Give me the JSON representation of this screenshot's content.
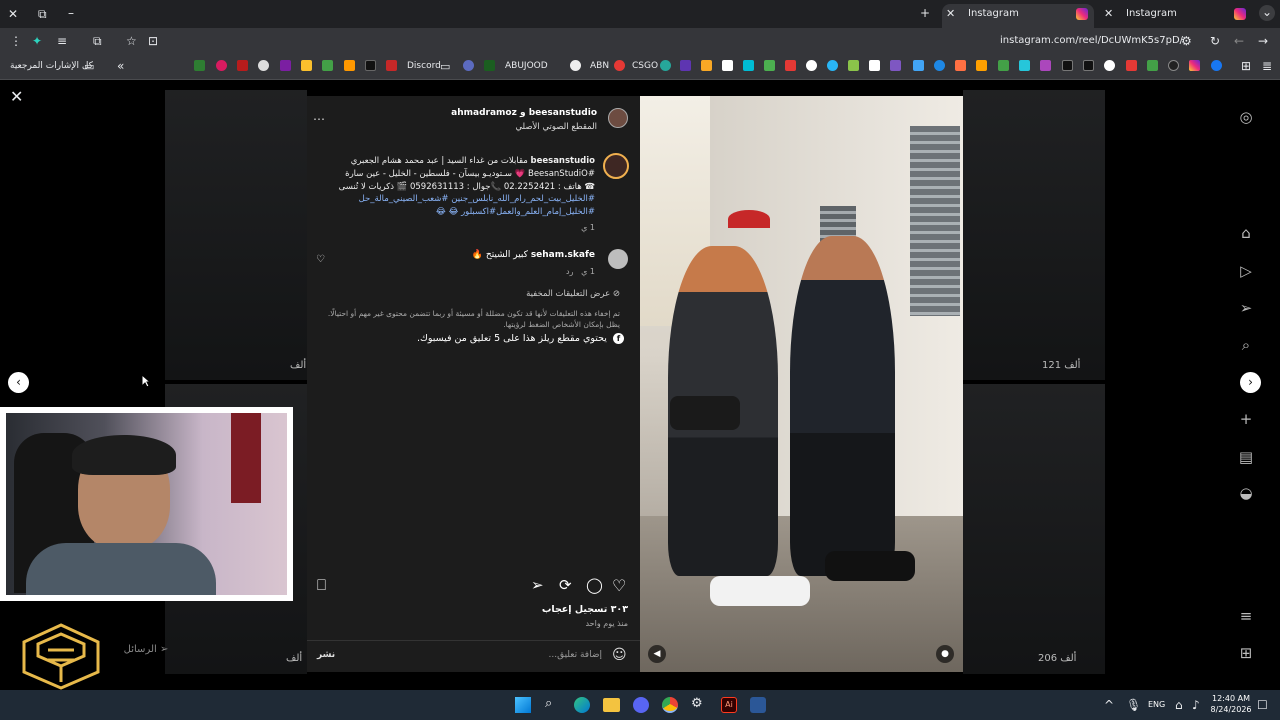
{
  "browser": {
    "tabs": [
      {
        "label": "Instagram",
        "active": true
      },
      {
        "label": "Instagram",
        "active": false
      }
    ],
    "url": "instagram.com/reel/DcUWmK5s7pD/",
    "bookmarks_all": "كل الإشارات المرجعية",
    "bookmark_labels": [
      "Discord",
      "ABUJOOD",
      "ABN",
      "CSGO"
    ]
  },
  "post": {
    "authors": "beesanstudio و ahmadramoz",
    "audio": "المقطع الصوتي الأصلي",
    "caption_user": "beesanstudio",
    "caption_line1": "مقابلات من غداء السيد | عبد محمد هشام الجعبري",
    "caption_line2": "#BeesanStudiO 💗 سـتوديـو بيسآن - فلسطين - الخليل - عين سارة",
    "caption_line3": "☎ هاتف : 02.2252421 📞جوال : 0592631113 🎬 ذكريات لا تُنسى",
    "caption_tags1": "#الخليل_بيت_لحم_رام_الله_نابلس_جنين #شعب_الصيني_مالة_حل",
    "caption_tags2": "#الخليل_إمام_العلم_والعمل#اكسبلور 😂 😂",
    "caption_time": "1 ي",
    "comment_user": "seham.skafe",
    "comment_text": "كبير الشيتح 🔥",
    "comment_time": "1 ي",
    "comment_reply": "رد",
    "hidden_comments": "عرض التعليقات المخفية",
    "hidden_note": "تم إخفاء هذه التعليقات لأنها قد تكون مضللة أو مسيئة أو ربما تتضمن محتوى غير مهم أو احتيالًا. يظل بإمكان الأشخاص الضغط لرؤيتها.",
    "fb_note": "يحتوي مقطع ريلز هذا على 5 تعليق من فيسبوك.",
    "likes": "٣٠٣ تسجيل إعجاب",
    "posted": "منذ يوم واحد",
    "comment_placeholder": "إضافة تعليق...",
    "post_button": "نشر"
  },
  "background": {
    "views_left": "ألف",
    "views_right1": "121 ألف",
    "views_right2": "206 ألف",
    "views_left2": "ألف"
  },
  "messages": "الرسائل",
  "taskbar": {
    "lang": "ENG",
    "time": "12:40 AM",
    "date": "8/24/2026"
  }
}
